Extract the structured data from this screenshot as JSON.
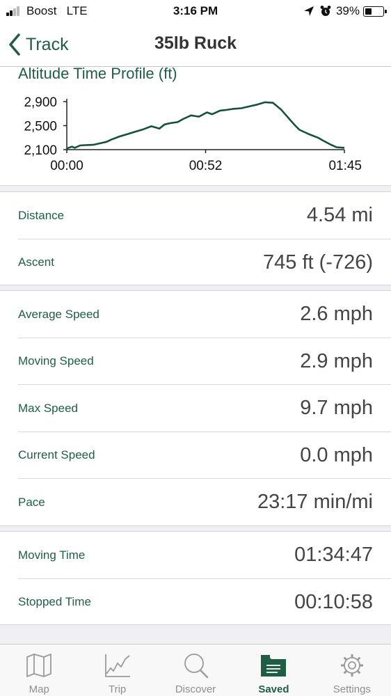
{
  "status_bar": {
    "carrier": "Boost",
    "network": "LTE",
    "time": "3:16 PM",
    "battery_percent": "39%",
    "battery_level": 0.39,
    "icons": [
      "signal-icon",
      "location-arrow-icon",
      "alarm-icon",
      "battery-icon"
    ]
  },
  "nav": {
    "back_label": "Track",
    "title": "35lb Ruck"
  },
  "chart_data": {
    "type": "line",
    "title": "Altitude Time Profile (ft)",
    "x_tick_labels": [
      "00:00",
      "00:52",
      "01:45"
    ],
    "y_tick_labels": [
      "2,900",
      "2,500",
      "2,100"
    ],
    "xlim": [
      0,
      105
    ],
    "ylim": [
      2100,
      2900
    ],
    "series": [
      {
        "color": "#15513a",
        "x": [
          0,
          2,
          3,
          5,
          7,
          10,
          12,
          15,
          17,
          20,
          23,
          26,
          29,
          32,
          35,
          37,
          39,
          42,
          44,
          47,
          50,
          53,
          55,
          58,
          60,
          63,
          66,
          69,
          72,
          75,
          78,
          81,
          84,
          86,
          88,
          90,
          92,
          95,
          97,
          100,
          102,
          105
        ],
        "y": [
          2120,
          2150,
          2130,
          2170,
          2175,
          2180,
          2200,
          2230,
          2270,
          2320,
          2360,
          2400,
          2440,
          2490,
          2450,
          2520,
          2540,
          2560,
          2610,
          2670,
          2650,
          2720,
          2690,
          2750,
          2760,
          2780,
          2790,
          2820,
          2850,
          2890,
          2880,
          2770,
          2620,
          2520,
          2430,
          2390,
          2350,
          2300,
          2250,
          2180,
          2140,
          2130
        ]
      }
    ]
  },
  "groups": [
    {
      "rows": [
        {
          "label": "Distance",
          "value": "4.54 mi"
        },
        {
          "label": "Ascent",
          "value": "745 ft (-726)"
        }
      ]
    },
    {
      "rows": [
        {
          "label": "Average Speed",
          "value": "2.6 mph"
        },
        {
          "label": "Moving Speed",
          "value": "2.9 mph"
        },
        {
          "label": "Max Speed",
          "value": "9.7 mph"
        },
        {
          "label": "Current Speed",
          "value": "0.0 mph"
        },
        {
          "label": "Pace",
          "value": "23:17 min/mi"
        }
      ]
    },
    {
      "rows": [
        {
          "label": "Moving Time",
          "value": "01:34:47"
        },
        {
          "label": "Stopped Time",
          "value": "00:10:58"
        }
      ]
    }
  ],
  "tabs": [
    {
      "label": "Map",
      "icon": "map-icon"
    },
    {
      "label": "Trip",
      "icon": "trip-chart-icon"
    },
    {
      "label": "Discover",
      "icon": "magnifier-icon"
    },
    {
      "label": "Saved",
      "icon": "saved-folder-icon",
      "active": true
    },
    {
      "label": "Settings",
      "icon": "settings-gear-icon"
    }
  ],
  "colors": {
    "accent": "#1f5e45",
    "inactive_tab": "#8e8e8e"
  }
}
